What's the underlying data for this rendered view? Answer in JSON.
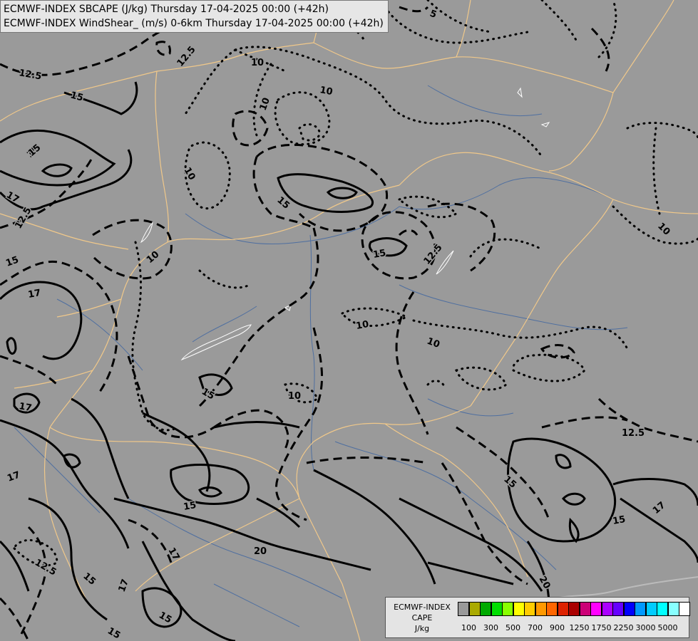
{
  "title": {
    "line1": "ECMWF-INDEX SBCAPE (J/kg) Thursday 17-04-2025 00:00 (+42h)",
    "line2": "ECMWF-INDEX WindShear_ (m/s) 0-6km Thursday 17-04-2025 00:00 (+42h)"
  },
  "legend": {
    "title_line1": "ECMWF-INDEX",
    "title_line2": "CAPE",
    "title_line3": "J/kg",
    "colors": [
      "#999999",
      "#aaaa00",
      "#00aa00",
      "#00dd00",
      "#88ff00",
      "#ffff00",
      "#ffcc00",
      "#ff9900",
      "#ff6600",
      "#dd2200",
      "#aa0000",
      "#cc0077",
      "#ff00ff",
      "#aa00ff",
      "#6600ff",
      "#0000ff",
      "#0099ff",
      "#00ccff",
      "#00ffff",
      "#88ffff",
      "#ffffff"
    ],
    "labels": [
      "100",
      "300",
      "500",
      "700",
      "900",
      "1250",
      "1750",
      "2250",
      "3000",
      "5000"
    ]
  },
  "contour_labels": [
    {
      "id": "l1",
      "text": "12.5"
    },
    {
      "id": "l2",
      "text": "12.5"
    },
    {
      "id": "l3",
      "text": "15"
    },
    {
      "id": "l4",
      "text": "15"
    },
    {
      "id": "l5",
      "text": "17"
    },
    {
      "id": "l6",
      "text": "12.5"
    },
    {
      "id": "l7",
      "text": "15"
    },
    {
      "id": "l8",
      "text": "17"
    },
    {
      "id": "l9",
      "text": "10"
    },
    {
      "id": "l10",
      "text": "10"
    },
    {
      "id": "l11",
      "text": "10"
    },
    {
      "id": "l12",
      "text": "10"
    },
    {
      "id": "l13",
      "text": "10"
    },
    {
      "id": "l14",
      "text": "5"
    },
    {
      "id": "l15",
      "text": "5"
    },
    {
      "id": "l16",
      "text": "15"
    },
    {
      "id": "l17",
      "text": "15"
    },
    {
      "id": "l18",
      "text": "12.5"
    },
    {
      "id": "l19",
      "text": "10"
    },
    {
      "id": "l20",
      "text": "10"
    },
    {
      "id": "l21",
      "text": "10"
    },
    {
      "id": "l22",
      "text": "10"
    },
    {
      "id": "l23",
      "text": "15"
    },
    {
      "id": "l24",
      "text": "17"
    },
    {
      "id": "l25",
      "text": "17"
    },
    {
      "id": "l26",
      "text": "15"
    },
    {
      "id": "l27",
      "text": "17"
    },
    {
      "id": "l28",
      "text": "20"
    },
    {
      "id": "l29",
      "text": "12.5"
    },
    {
      "id": "l30",
      "text": "15"
    },
    {
      "id": "l31",
      "text": "15"
    },
    {
      "id": "l32",
      "text": "15"
    },
    {
      "id": "l33",
      "text": "17"
    },
    {
      "id": "l34",
      "text": "12.5"
    },
    {
      "id": "l35",
      "text": "15"
    },
    {
      "id": "l36",
      "text": "15"
    },
    {
      "id": "l37",
      "text": "17"
    },
    {
      "id": "l38",
      "text": "20"
    },
    {
      "id": "l39",
      "text": "15"
    }
  ]
}
